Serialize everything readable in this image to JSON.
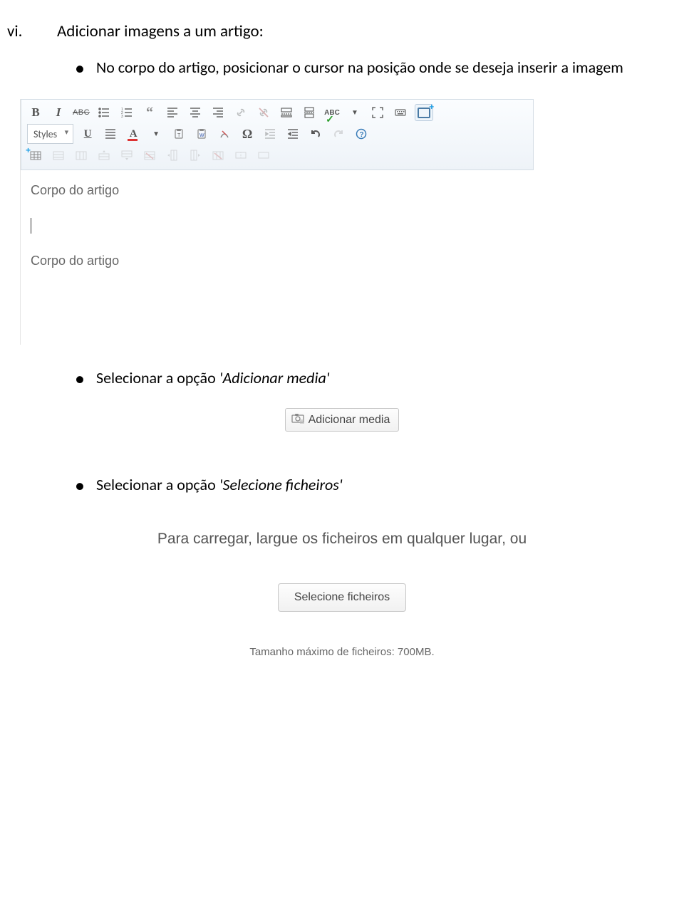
{
  "section": {
    "number": "vi.",
    "title": "Adicionar imagens a um artigo:"
  },
  "bullets": {
    "b1": "No corpo do artigo, posicionar o cursor na posição onde se deseja inserir a imagem",
    "b2_prefix": "Selecionar a opção ",
    "b2_em": "'Adicionar media'",
    "b3_prefix": "Selecionar a opção ",
    "b3_em": "'Selecione ficheiros'"
  },
  "editor": {
    "styles_label": "Styles",
    "content_line1": "Corpo do artigo",
    "content_line2": "Corpo do artigo"
  },
  "media_button": {
    "label": "Adicionar media"
  },
  "dropzone": {
    "hint": "Para carregar, largue os ficheiros em qualquer lugar, ou",
    "button": "Selecione ficheiros",
    "max": "Tamanho máximo de ficheiros: 700MB."
  }
}
